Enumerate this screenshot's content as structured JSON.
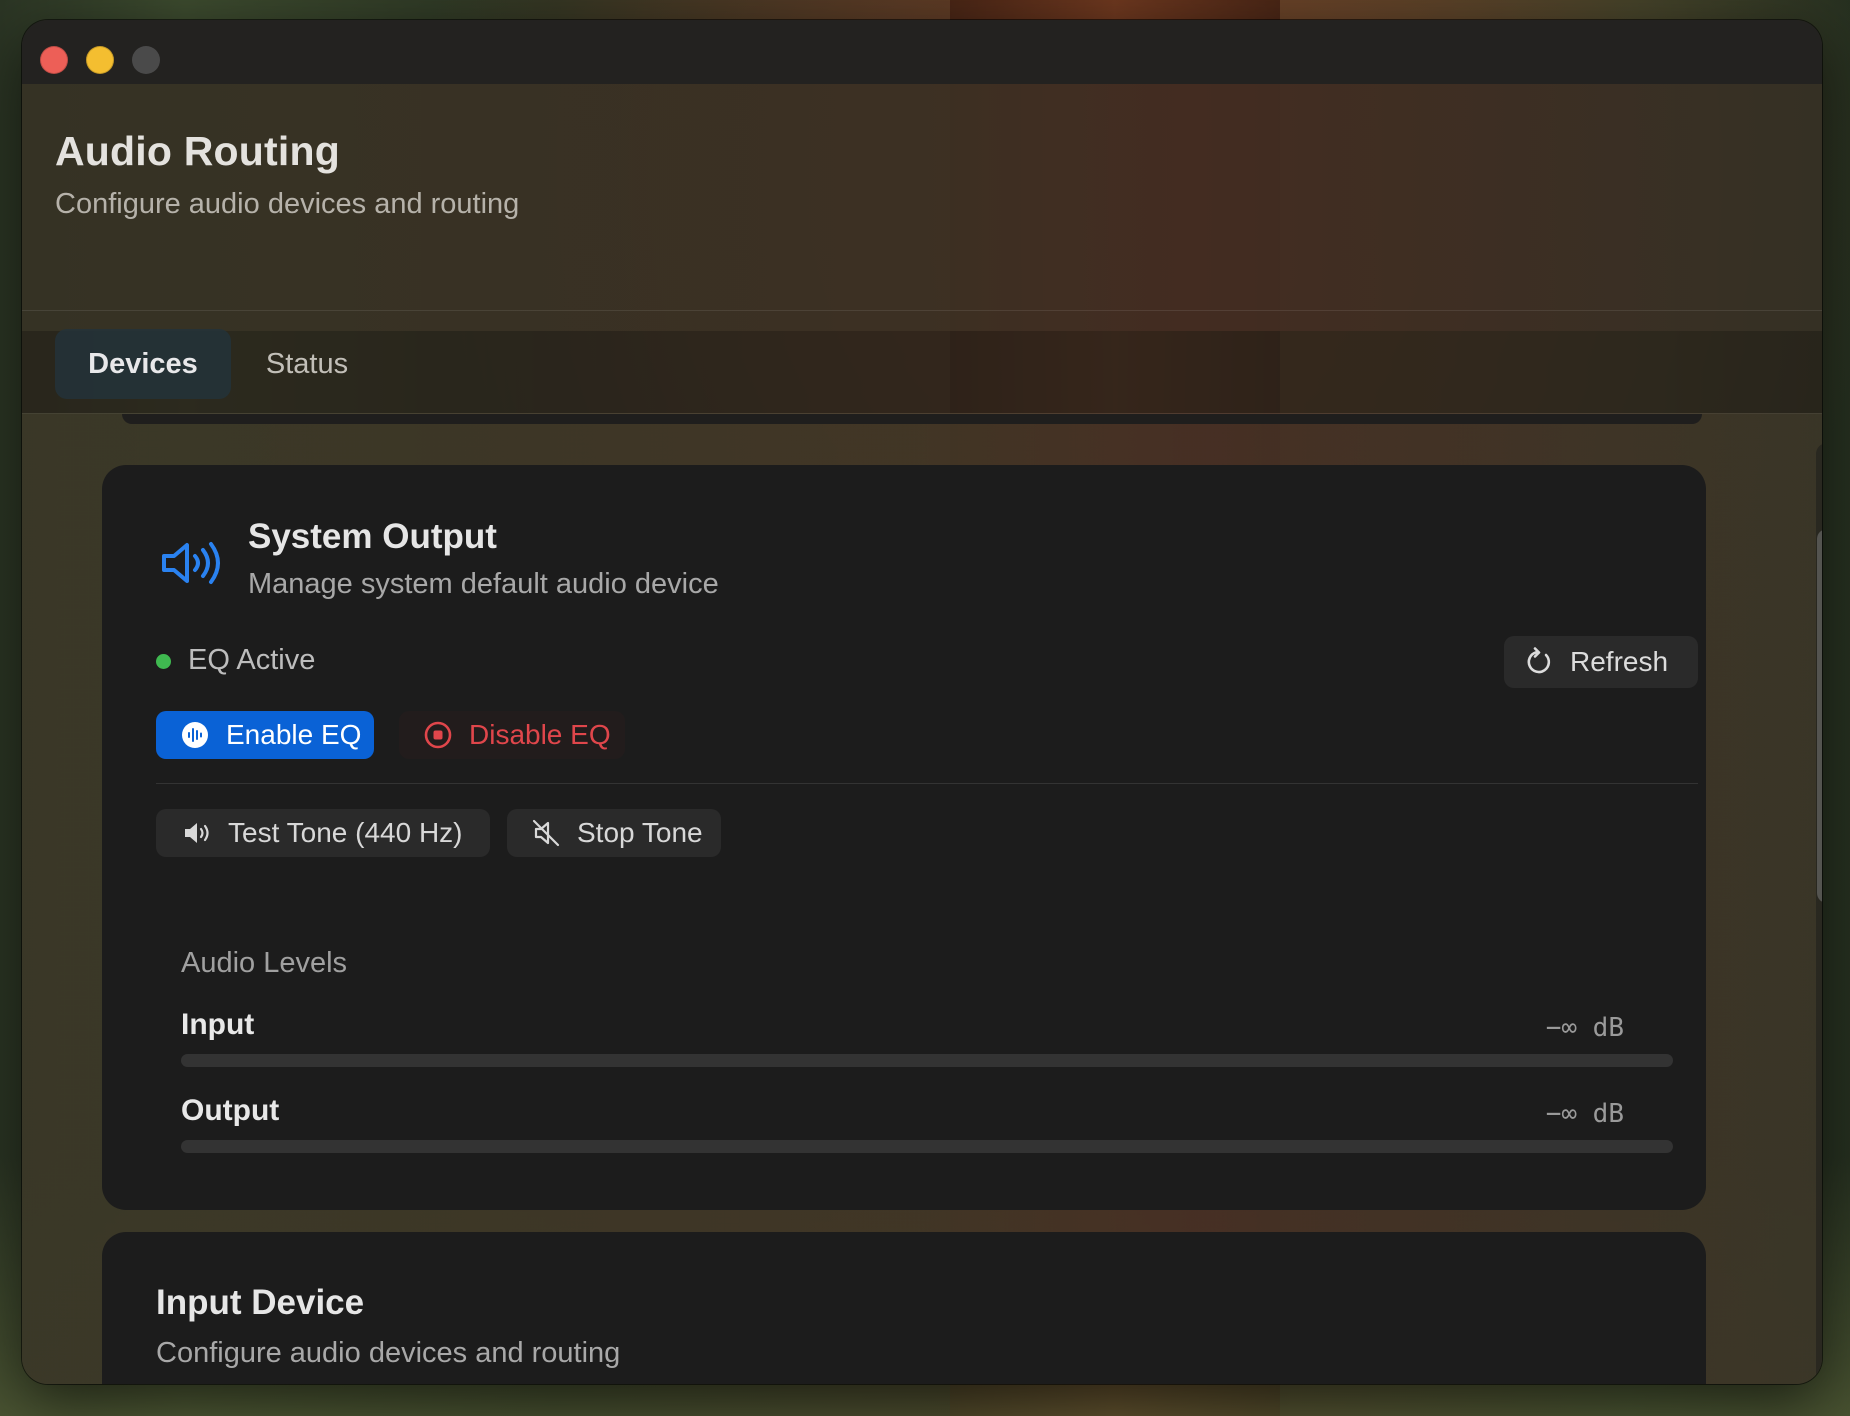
{
  "app": {
    "title": "Audio Routing",
    "subtitle": "Configure audio devices and routing"
  },
  "tabs": [
    {
      "label": "Devices",
      "selected": true
    },
    {
      "label": "Status",
      "selected": false
    }
  ],
  "system_output": {
    "icon": "speaker-wave-icon",
    "title": "System Output",
    "subtitle": "Manage system default audio device",
    "status_text": "EQ Active",
    "status_color": "#3fb950",
    "refresh_label": "Refresh",
    "enable_eq_label": "Enable EQ",
    "disable_eq_label": "Disable EQ",
    "test_tone_label": "Test Tone (440 Hz)",
    "stop_tone_label": "Stop Tone",
    "accent_color": "#0a62d6",
    "danger_color": "#e0464b"
  },
  "audio_levels": {
    "heading": "Audio Levels",
    "input": {
      "label": "Input",
      "value": "−∞ dB",
      "level": 0
    },
    "output": {
      "label": "Output",
      "value": "−∞ dB",
      "level": 0
    }
  },
  "input_device": {
    "title": "Input Device",
    "subtitle": "Configure audio devices and routing"
  }
}
